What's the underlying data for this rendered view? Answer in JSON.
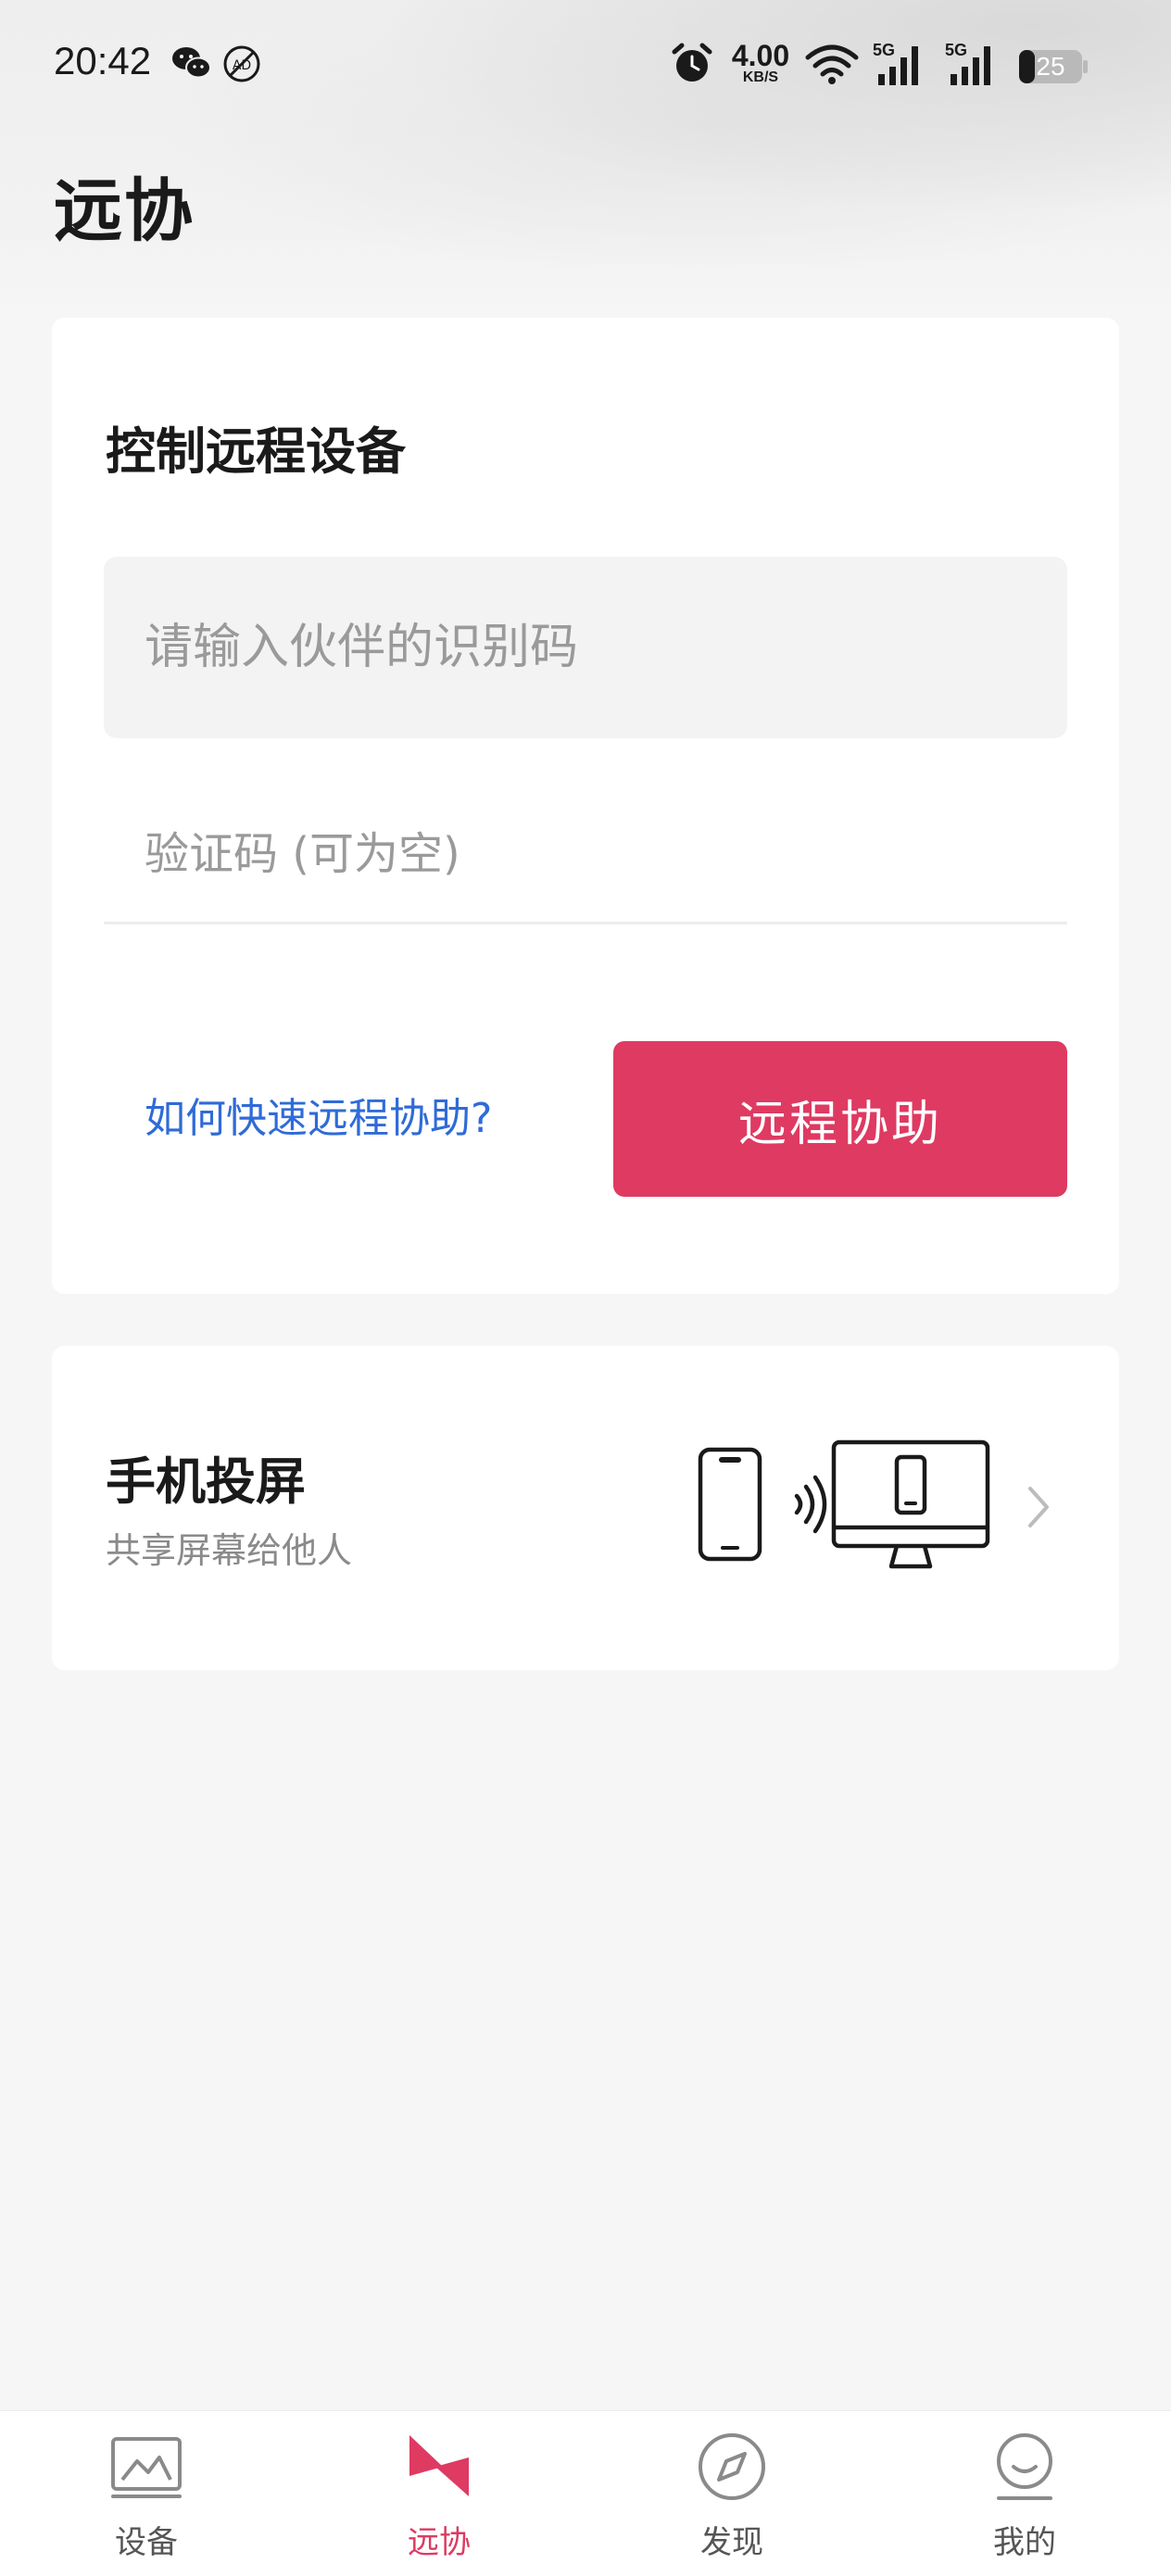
{
  "status_bar": {
    "time": "20:42",
    "net_speed_value": "4.00",
    "net_speed_unit": "KB/S",
    "sim1_label": "5G",
    "sim2_label": "5G",
    "battery_level": "25",
    "icons": [
      "wechat-icon",
      "no-ad-icon",
      "alarm-icon",
      "wifi-icon",
      "signal-icon",
      "signal-icon",
      "battery-icon"
    ]
  },
  "header": {
    "title": "远协"
  },
  "remote_card": {
    "title": "控制远程设备",
    "id_placeholder": "请输入伙伴的识别码",
    "code_placeholder": "验证码 (可为空)",
    "help_link": "如何快速远程协助?",
    "assist_button": "远程协助"
  },
  "cast_card": {
    "title": "手机投屏",
    "subtitle": "共享屏幕给他人"
  },
  "tabbar": {
    "active_color": "#de3a62",
    "items": [
      {
        "label": "设备",
        "icon": "devices-icon"
      },
      {
        "label": "远协",
        "icon": "remote-assist-icon",
        "active": true
      },
      {
        "label": "发现",
        "icon": "compass-icon"
      },
      {
        "label": "我的",
        "icon": "profile-icon"
      }
    ]
  }
}
